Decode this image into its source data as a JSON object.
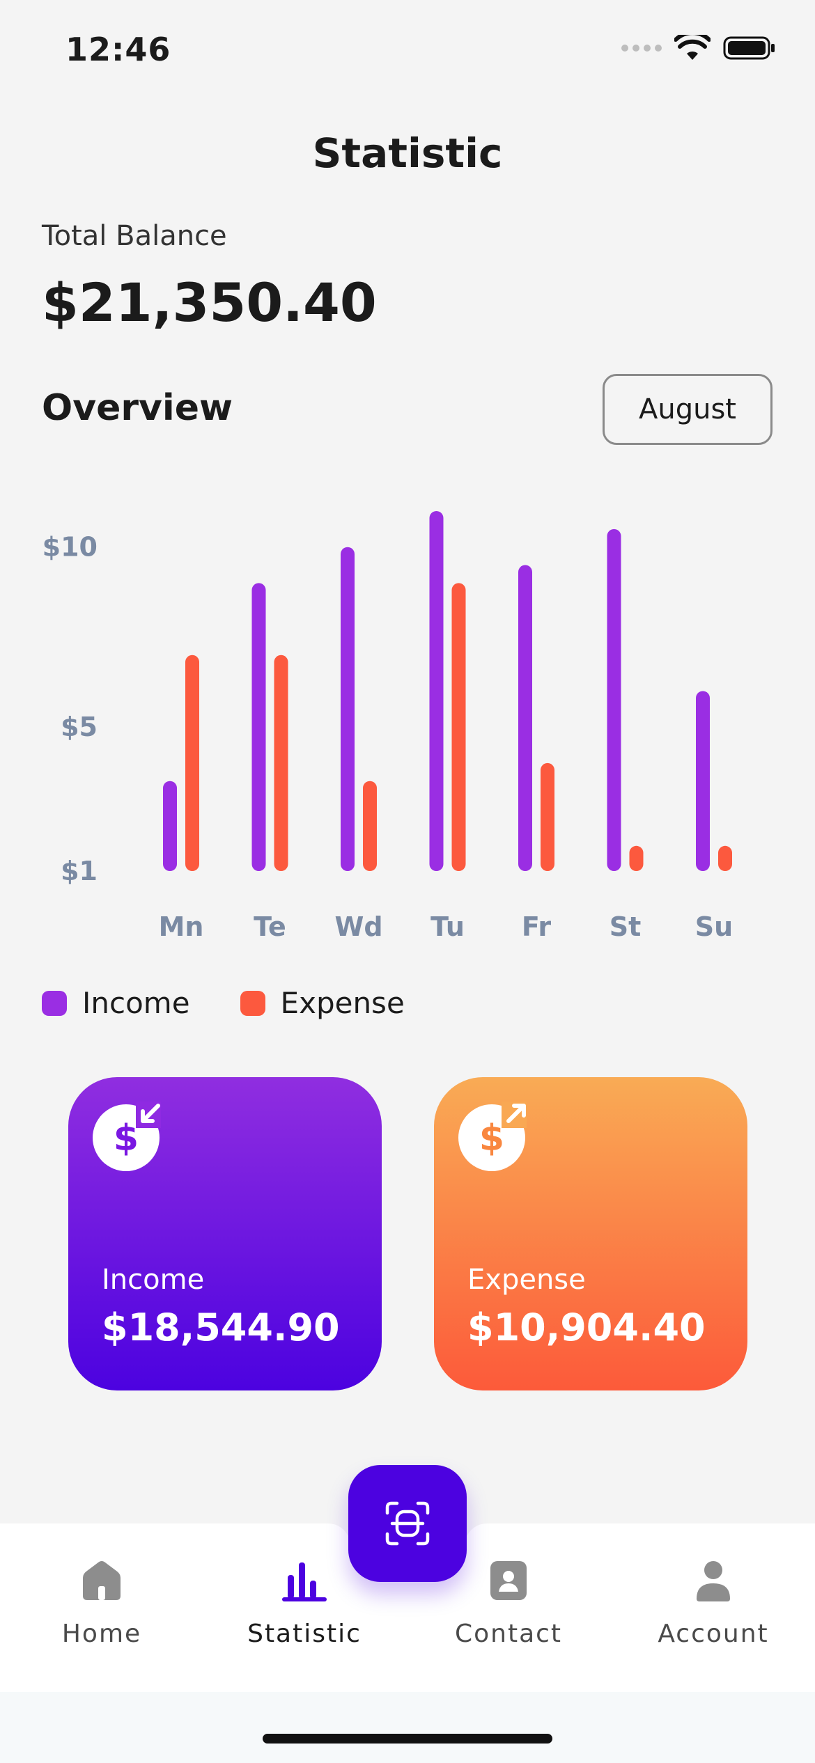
{
  "status_bar": {
    "time": "12:46"
  },
  "page": {
    "title": "Statistic"
  },
  "balance": {
    "label": "Total Balance",
    "value": "$21,350.40"
  },
  "overview": {
    "title": "Overview",
    "month": "August"
  },
  "colors": {
    "income": "#9a2ee3",
    "expense": "#fc593e",
    "accent": "#4c02e0",
    "axis_text": "#7a8aa3"
  },
  "chart_data": {
    "type": "bar",
    "categories": [
      "Mn",
      "Te",
      "Wd",
      "Tu",
      "Fr",
      "St",
      "Su"
    ],
    "y_ticks": [
      "$10",
      "$5",
      "$1"
    ],
    "ylim": [
      1,
      11
    ],
    "series": [
      {
        "name": "Income",
        "values": [
          3.5,
          9,
          10,
          11,
          9.5,
          10.5,
          6
        ]
      },
      {
        "name": "Expense",
        "values": [
          7,
          7,
          3.5,
          9,
          4,
          1.7,
          1.7
        ]
      }
    ],
    "legend": "bottom-left",
    "grid": false
  },
  "cards": {
    "income": {
      "label": "Income",
      "value": "$18,544.90",
      "icon": "dollar-in-icon"
    },
    "expense": {
      "label": "Expense",
      "value": "$10,904.40",
      "icon": "dollar-out-icon"
    }
  },
  "nav": {
    "items": [
      {
        "label": "Home",
        "icon": "home-icon"
      },
      {
        "label": "Statistic",
        "icon": "bar-chart-icon"
      },
      {
        "label": "Contact",
        "icon": "contact-icon"
      },
      {
        "label": "Account",
        "icon": "person-icon"
      }
    ],
    "active": "Statistic",
    "fab_icon": "scan-icon"
  }
}
